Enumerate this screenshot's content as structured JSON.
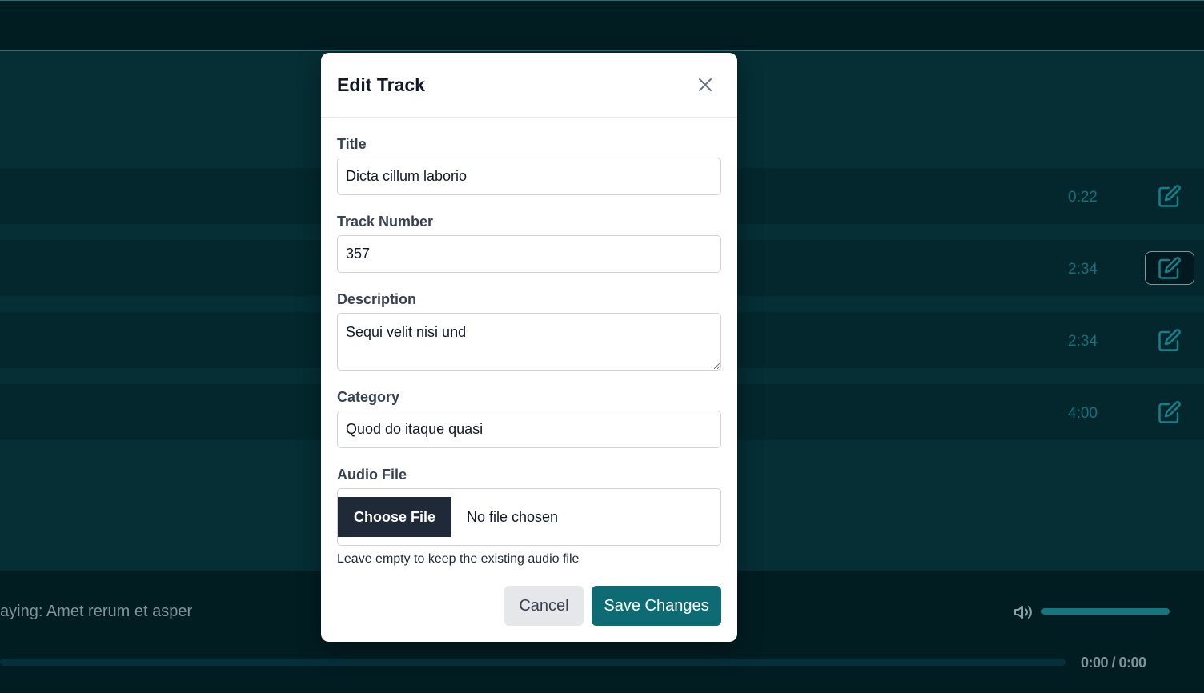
{
  "tracks": [
    {
      "duration": "0:22"
    },
    {
      "duration": "2:34"
    },
    {
      "duration": "2:34"
    },
    {
      "duration": "4:00"
    }
  ],
  "player": {
    "now_playing": "aying: Amet rerum et asper",
    "time": "0:00 / 0:00",
    "volume_level": 1.0,
    "progress_level": 0.0
  },
  "modal": {
    "title": "Edit Track",
    "fields": {
      "title_label": "Title",
      "title_value": "Dicta cillum laborio",
      "track_number_label": "Track Number",
      "track_number_value": "357",
      "description_label": "Description",
      "description_value": "Sequi velit nisi und",
      "category_label": "Category",
      "category_value": "Quod do itaque quasi",
      "audio_label": "Audio File",
      "choose_file_label": "Choose File",
      "no_file_text": "No file chosen",
      "audio_help": "Leave empty to keep the existing audio file"
    },
    "cancel_label": "Cancel",
    "save_label": "Save Changes"
  },
  "colors": {
    "accent": "#0e6b73",
    "background": "#052e35",
    "track_duration": "#16707a"
  },
  "icons": {
    "close": "close-icon",
    "edit": "edit-icon",
    "volume": "volume-icon"
  }
}
